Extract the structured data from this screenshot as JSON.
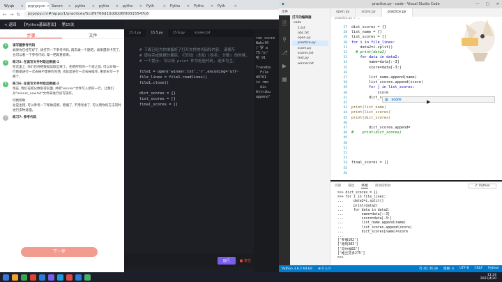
{
  "browser": {
    "tabs": [
      {
        "label": "Wyqb"
      },
      {
        "label": "pypypy.cn"
      },
      {
        "label": "Sarcm"
      },
      {
        "label": "pytho"
      },
      {
        "label": "pytho"
      },
      {
        "label": "pytho"
      },
      {
        "label": "Pyth"
      },
      {
        "label": "Pytho"
      },
      {
        "label": "Pytho"
      },
      {
        "label": "Pyth"
      }
    ],
    "url": "pypypy.cn/#/apps/1/practices/5cdf9766d10d0b06f00015547c6"
  },
  "site": {
    "back": "< 返回",
    "title": "【Python基础语法】 · 第15关"
  },
  "left_panel": {
    "tabs": [
      "步骤",
      "文件"
    ],
    "steps": [
      {
        "num": "4",
        "title": "读写题参考代码",
        "body": "如果你已经写好了, 请打开一下参考代码, 再去做一个题吧。如果遇到卡壳了, 也可以看一下参考代码, 帮一把再重新来。"
      },
      {
        "num": "5",
        "title": "练习5: 在读写文件时取出数据-1",
        "body": "在这里上, 你们已经把数据读取出来了。先把所有的一个组之前, 可以对每一行数据进行一次去掉不需要的东西, 也就是进行一次去掉操作, 重新去写一下那个。"
      },
      {
        "num": "6",
        "title": "练习6: 在读写文件时取出数据-2",
        "body": "现在, 我们在把分数取得前面, 并把\"winner\"文件写入新的一行。让我们对\"winner_new.txt\"文件来进行读写操作。"
      },
      {
        "num": "",
        "title": "",
        "body": "总是出错, 可以参考一下帮助说明。看懂了, 不用考虑了, 可以用你的方法同时进行多种处理。"
      },
      {
        "num": "7",
        "title": "练习7: 参考代码",
        "body": ""
      }
    ],
    "tip_label": "切换帮助",
    "next_button": "下一步",
    "watermark": "刘心42"
  },
  "editor": {
    "tabs": [
      "15.4.py",
      "15.5.py",
      "15.6.py",
      "scores.txt"
    ],
    "active_tab": 1,
    "lines": [
      "# 下面已经为你准备好了打开文件的代码和内容, 请保存",
      "# 请在完成数据分离后, 打印出 (形如 (姓名: 分数) 的时候,",
      "# 一个提示: 可以用 print 作为检验代码, 逐步为主。",
      "",
      "file1 = open('winner.txt','r',encoding='utf-",
      "file_lines = file1.readlines()",
      "file1.close()",
      "",
      "dict_scores = {}",
      "list_scores = []",
      "final_scores = []"
    ],
    "run_label": "运行",
    "stop_label": "■ 复位"
  },
  "console": {
    "lines": [
      "run_score",
      "Wabcf0",
      "('罗 a",
      "75:\\n'",
      "哈 91",
      "",
      "Traceba",
      "  File",
      "d9761",
      "in <mo",
      "  dic",
      "Attribu",
      "append'"
    ]
  },
  "vscode": {
    "title": "practice.py - code - Visual Studio Code",
    "menu": [
      "文件",
      "编辑",
      "选择",
      "查看"
    ],
    "explorer_title": "打开的编辑器",
    "explorer_items": [
      "code",
      "1.txt",
      "abc.txt",
      "open.py",
      "practice.py",
      "score.py",
      "scores.txt",
      "test.py",
      "winner.txt"
    ],
    "tabs": [
      "open.py",
      "score.py",
      "practice.py"
    ],
    "active_tab": 2,
    "breadcrumb": "practice.py > ...",
    "line_numbers": [
      27,
      28,
      29,
      30,
      31,
      32,
      33,
      34,
      35,
      36,
      37,
      38,
      39,
      40,
      41,
      42,
      43,
      44,
      45,
      46,
      47,
      48,
      49,
      50,
      51,
      52,
      53,
      54,
      55,
      56
    ],
    "code": [
      "dict_scores = {}",
      "list_name = []",
      "list_scores = []",
      "for i in file_lines:",
      "    data2=i.split()",
      "  # print(data2)",
      "    for data in data2:",
      "        name=data[:-3]",
      "        score=data[-3:]",
      "",
      "        list_name.append(name)",
      "        list_scores.append(score)",
      "        for j in list_scores:",
      "            score",
      "        dict_score",
      "",
      "print(list_name)",
      "print(list_scores)",
      "print(dict_scores)",
      "",
      "        dict_scores.append=",
      "#    print(dict_scores)",
      "",
      "",
      "",
      "",
      "",
      "final_scores = []",
      "",
      ""
    ],
    "suggestion": "score",
    "panel_tabs": [
      "问题",
      "输出",
      "终端",
      "调试控制台"
    ],
    "active_panel": 2,
    "terminal_select": "2: Python",
    "terminal_lines": [
      ">>> dict_scores = {}",
      ">>> for i in file_lines:",
      "...     data2=i.split()",
      "...     print(data2)",
      "...     for data in data2:",
      "...         name=data[:-3]",
      "...         score=data[-3:]",
      "...         list_name.append(name)",
      "...         list_scores.append(score)",
      "...         dict_scores[name]=score",
      "...",
      "['罗恩102']",
      "['哈利383']",
      "['马尔福82']",
      "['格兰芬多275']",
      ">>> "
    ],
    "status_left": "Python 3.8.2 64-bit",
    "status_errors": "⊗ 0  ⚠ 0",
    "status_right": [
      "行 40, 列 38",
      "空格: 4",
      "UTF-8",
      "CRLF",
      "Python"
    ]
  },
  "taskbar": {
    "time": "11:24",
    "date": "2021/4/20"
  }
}
